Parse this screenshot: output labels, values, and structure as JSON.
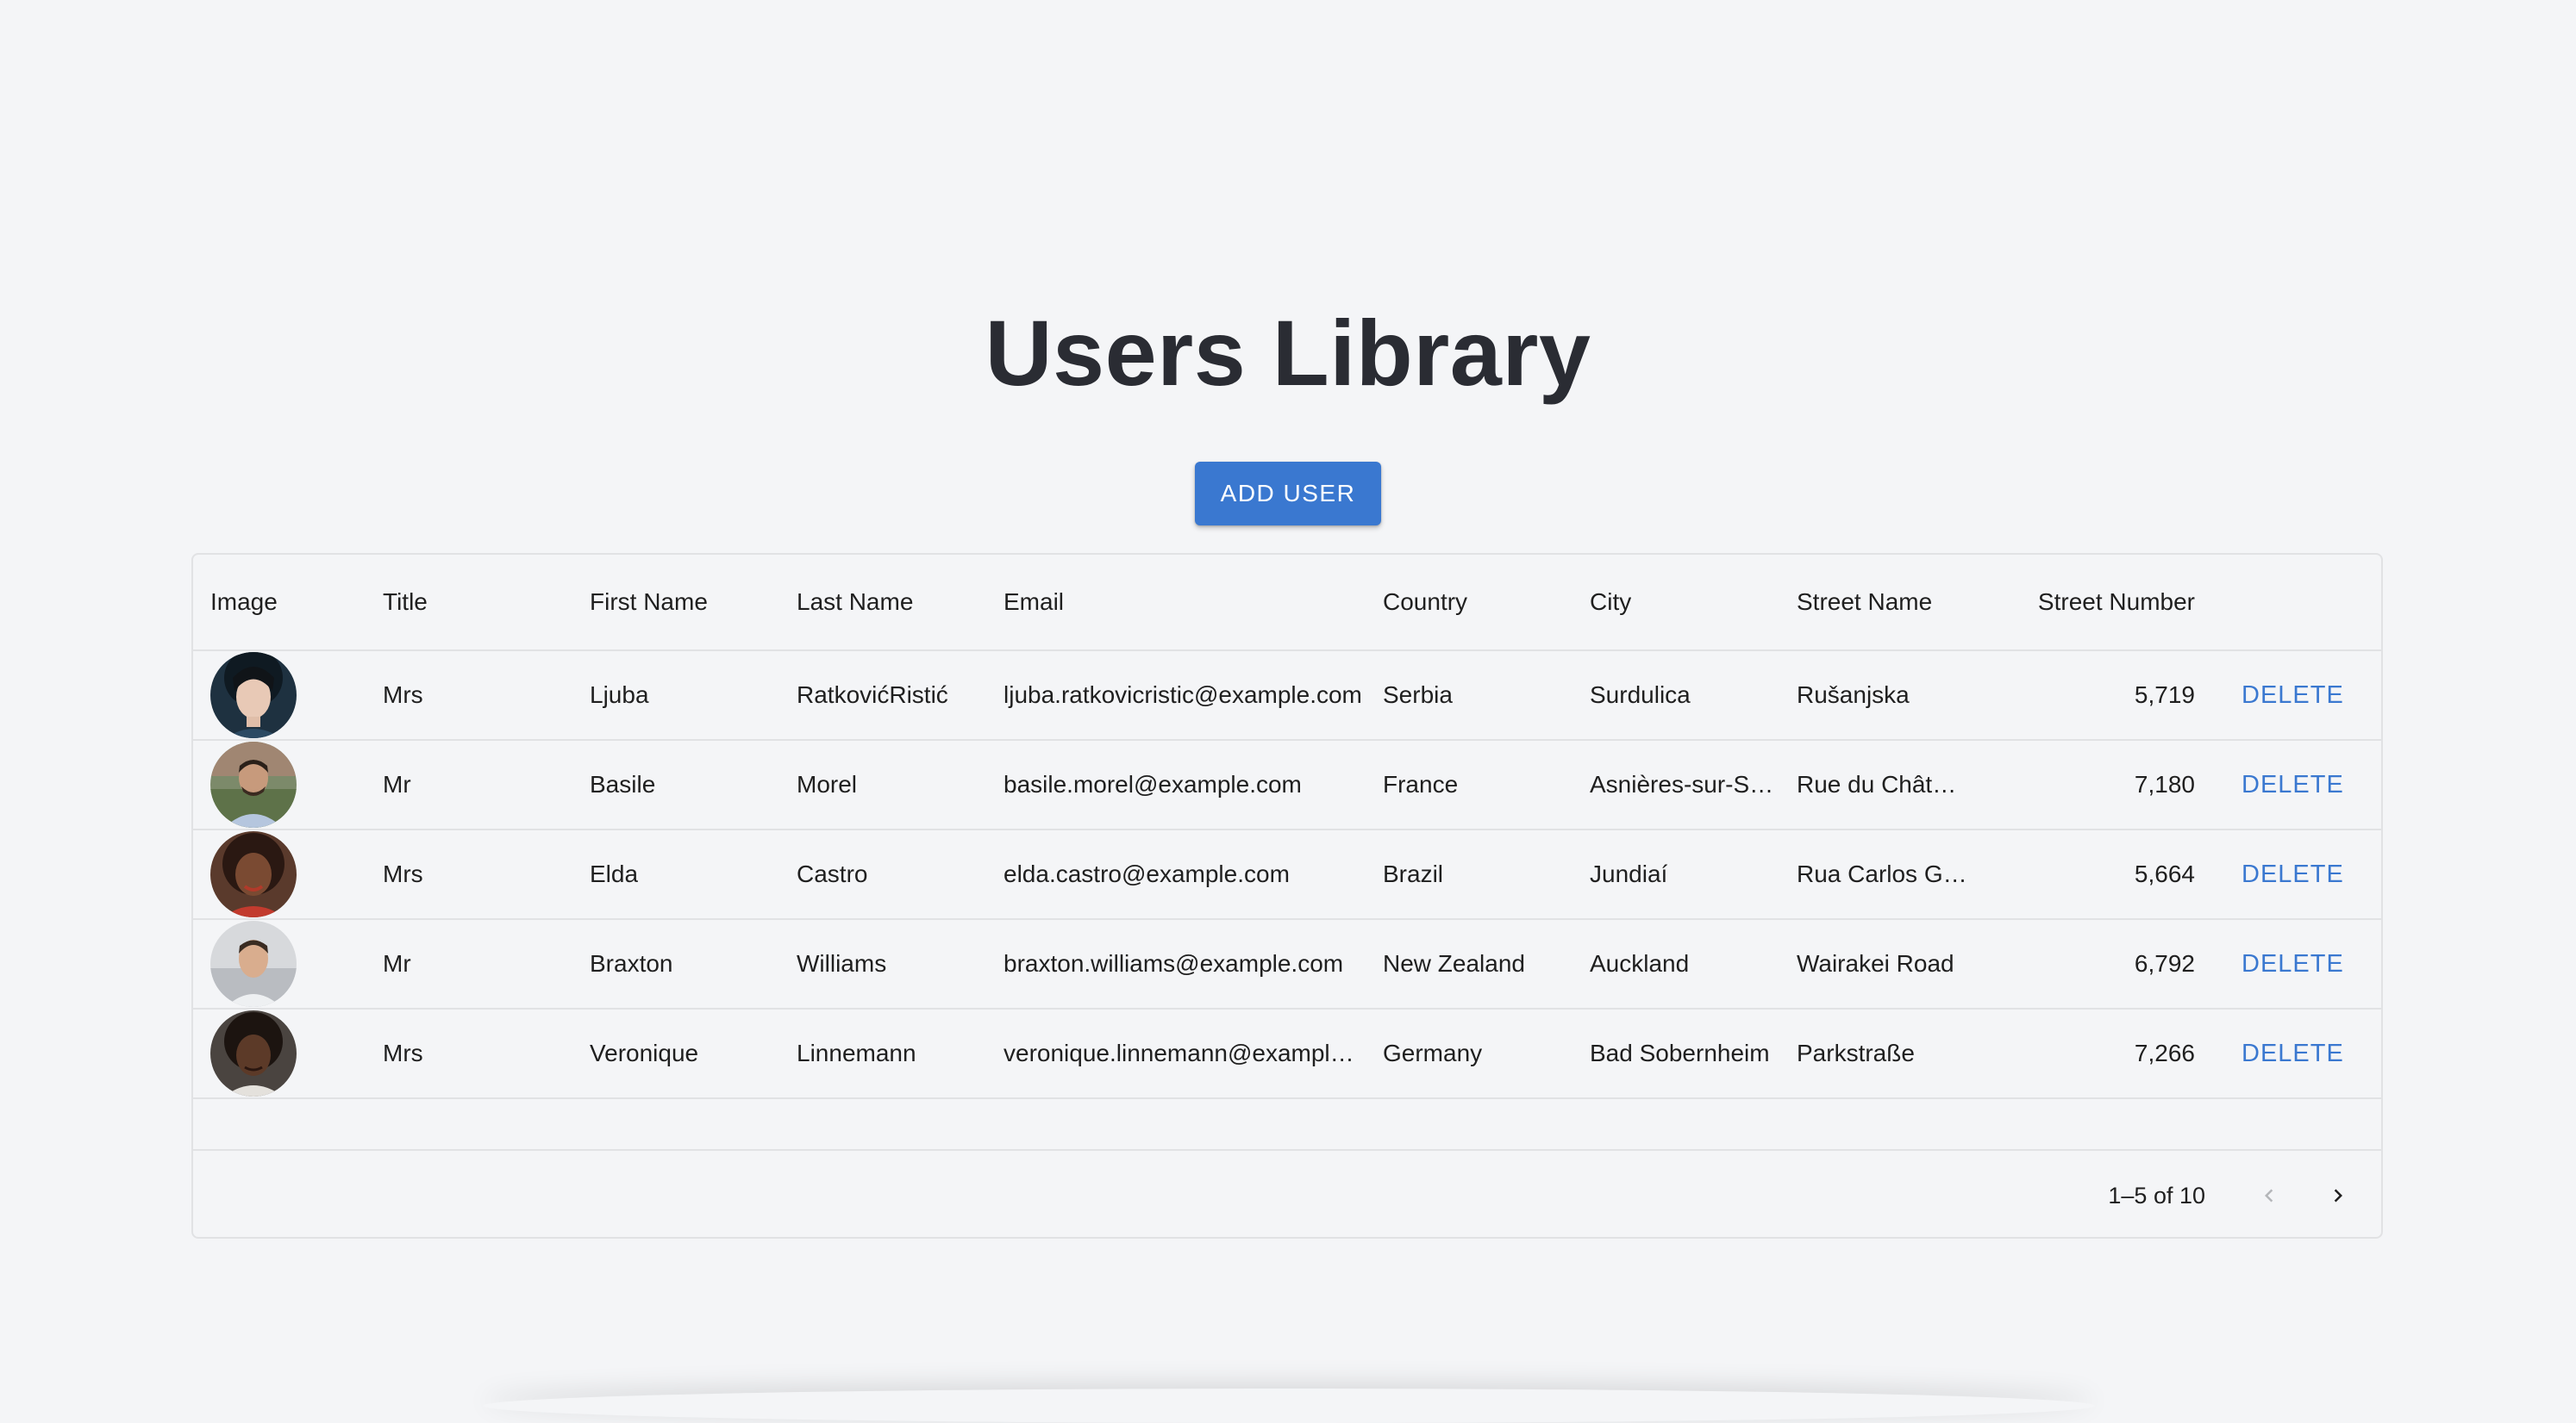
{
  "page": {
    "title": "Users Library",
    "add_user_label": "ADD USER"
  },
  "table": {
    "columns": [
      "Image",
      "Title",
      "First Name",
      "Last Name",
      "Email",
      "Country",
      "City",
      "Street Name",
      "Street Number"
    ],
    "rows": [
      {
        "title": "Mrs",
        "first": "Ljuba",
        "last": "RatkovićRistić",
        "email": "ljuba.ratkovicristic@example.com",
        "country": "Serbia",
        "city": "Surdulica",
        "street": "Rušanjska",
        "number": "5,719",
        "action": "DELETE"
      },
      {
        "title": "Mr",
        "first": "Basile",
        "last": "Morel",
        "email": "basile.morel@example.com",
        "country": "France",
        "city": "Asnières-sur-Seine",
        "street": "Rue du Château",
        "number": "7,180",
        "action": "DELETE"
      },
      {
        "title": "Mrs",
        "first": "Elda",
        "last": "Castro",
        "email": "elda.castro@example.com",
        "country": "Brazil",
        "city": "Jundiaí",
        "street": "Rua Carlos Gomes",
        "number": "5,664",
        "action": "DELETE"
      },
      {
        "title": "Mr",
        "first": "Braxton",
        "last": "Williams",
        "email": "braxton.williams@example.com",
        "country": "New Zealand",
        "city": "Auckland",
        "street": "Wairakei Road",
        "number": "6,792",
        "action": "DELETE"
      },
      {
        "title": "Mrs",
        "first": "Veronique",
        "last": "Linnemann",
        "email": "veronique.linnemann@example.com",
        "country": "Germany",
        "city": "Bad Sobernheim",
        "street": "Parkstraße",
        "number": "7,266",
        "action": "DELETE"
      }
    ]
  },
  "pagination": {
    "range_label": "1–5 of 10",
    "prev_icon": "chevron-left-icon",
    "next_icon": "chevron-right-icon"
  },
  "colors": {
    "background": "#f4f5f7",
    "accent": "#3a78d0",
    "title_text": "#2a2c33",
    "border": "#e1e2e4"
  }
}
